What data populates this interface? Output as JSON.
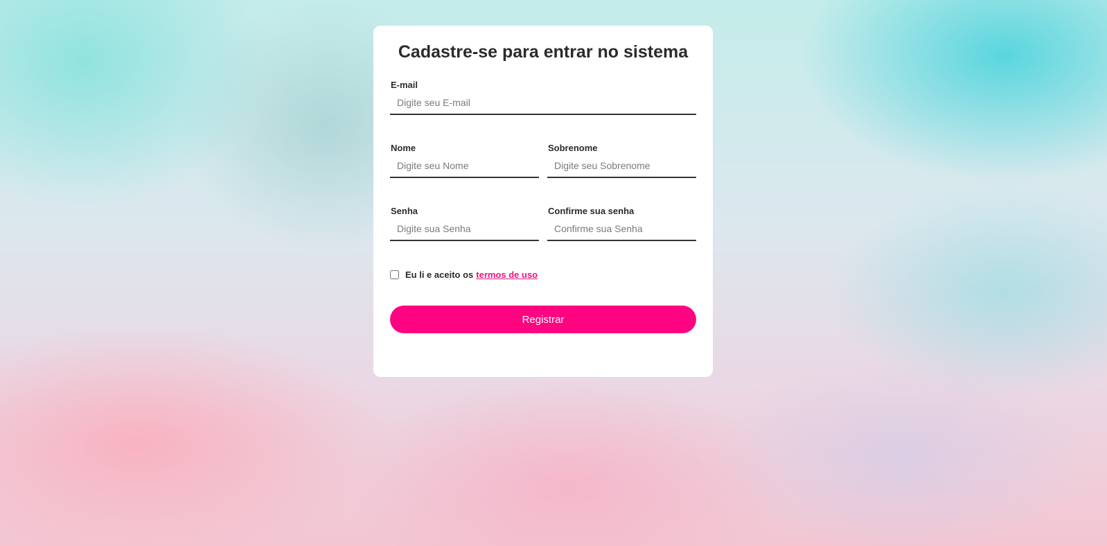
{
  "form": {
    "title": "Cadastre-se para entrar no sistema",
    "email": {
      "label": "E-mail",
      "placeholder": "Digite seu E-mail",
      "value": ""
    },
    "nome": {
      "label": "Nome",
      "placeholder": "Digite seu Nome",
      "value": ""
    },
    "sobrenome": {
      "label": "Sobrenome",
      "placeholder": "Digite seu Sobrenome",
      "value": ""
    },
    "senha": {
      "label": "Senha",
      "placeholder": "Digite sua Senha",
      "value": ""
    },
    "confirme": {
      "label": "Confirme sua senha",
      "placeholder": "Confirme sua Senha",
      "value": ""
    },
    "terms": {
      "text": "Eu li e aceito os",
      "link": "termos de uso",
      "checked": false
    },
    "submit_label": "Registrar"
  },
  "colors": {
    "accent": "#ff0480",
    "link": "#e8137f",
    "card": "#ffffff",
    "text": "#2b2b2b"
  }
}
